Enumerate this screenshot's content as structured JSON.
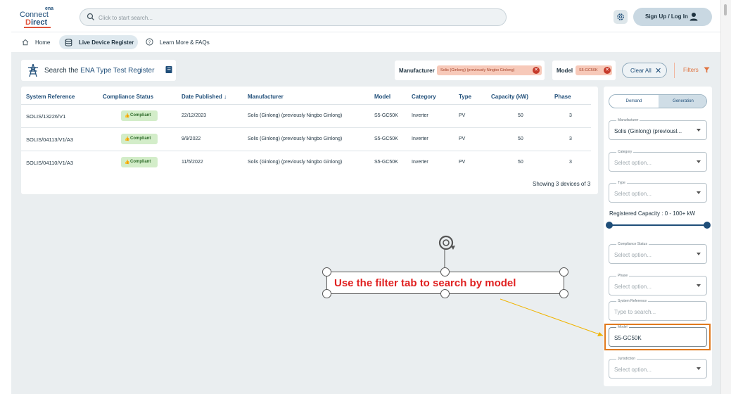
{
  "header": {
    "logo_small": "ena",
    "logo_line1": "Connect",
    "logo_d": "D",
    "logo_line2": "irect",
    "search_placeholder": "Click to start search...",
    "signup_label": "Sign Up / Log In"
  },
  "nav": {
    "home": "Home",
    "live": "Live Device Register",
    "faq": "Learn More & FAQs"
  },
  "title": {
    "prefix": "Search the ",
    "highlight": "ENA Type Test Register"
  },
  "active_filters": {
    "manufacturer_label": "Manufacturer",
    "manufacturer_value": "Solis (Ginlong) (previously Ningbo Ginlong)",
    "model_label": "Model",
    "model_value": "S5-GC50K",
    "clear_all": "Clear All",
    "filters": "Filters"
  },
  "table": {
    "headers": [
      "System Reference",
      "Compliance Status",
      "Date Published ↓",
      "Manufacturer",
      "Model",
      "Category",
      "Type",
      "Capacity (kW)",
      "Phase"
    ],
    "rows": [
      {
        "ref": "SOLIS/13226/V1",
        "status": "Compliant",
        "date": "22/12/2023",
        "manufacturer": "Solis (Ginlong) (previously Ningbo Ginlong)",
        "model": "S5-GC50K",
        "category": "Inverter",
        "type": "PV",
        "capacity": "50",
        "phase": "3"
      },
      {
        "ref": "SOLIS/04113/V1/A3",
        "status": "Compliant",
        "date": "9/9/2022",
        "manufacturer": "Solis (Ginlong) (previously Ningbo Ginlong)",
        "model": "S5-GC50K",
        "category": "Inverter",
        "type": "PV",
        "capacity": "50",
        "phase": "3"
      },
      {
        "ref": "SOLIS/04110/V1/A3",
        "status": "Compliant",
        "date": "11/5/2022",
        "manufacturer": "Solis (Ginlong) (previously Ningbo Ginlong)",
        "model": "S5-GC50K",
        "category": "Inverter",
        "type": "PV",
        "capacity": "50",
        "phase": "3"
      }
    ],
    "showing": "Showing 3 devices of 3"
  },
  "filter_panel": {
    "tab_demand": "Demand",
    "tab_generation": "Generation",
    "manufacturer_label": "Manufacturer",
    "manufacturer_value": "Solis (Ginlong) (previousl...",
    "category_label": "Category",
    "category_placeholder": "Select option...",
    "type_label": "Type",
    "type_placeholder": "Select option...",
    "capacity_label": "Registered Capacity : 0 - 100+ kW",
    "compliance_label": "Compliance Status",
    "compliance_placeholder": "Select option...",
    "phase_label": "Phase",
    "phase_placeholder": "Select option...",
    "sysref_label": "System Reference",
    "sysref_placeholder": "Type to search...",
    "model_label": "Model",
    "model_value": "S5-GC50K",
    "jurisdiction_label": "Jurisdiction",
    "jurisdiction_placeholder": "Select option..."
  },
  "annotation": {
    "text": "Use the filter tab to search by model"
  }
}
